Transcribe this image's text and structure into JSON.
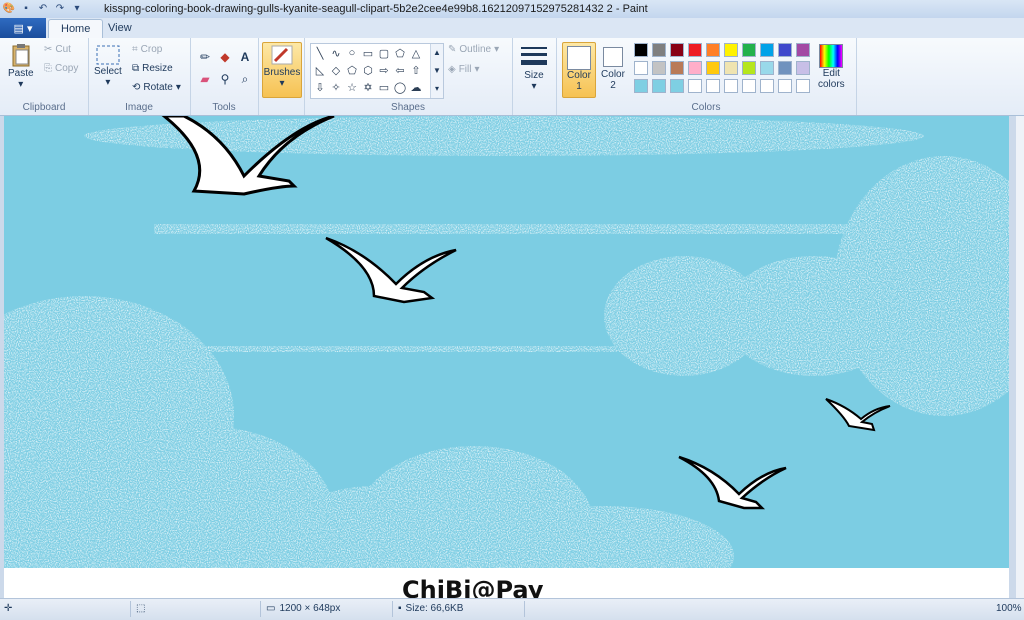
{
  "window": {
    "title": "kisspng-coloring-book-drawing-gulls-kyanite-seagull-clipart-5b2e2cee4e99b8.16212097152975281432 2 - Paint"
  },
  "tabs": [
    {
      "label": "Home"
    },
    {
      "label": "View"
    }
  ],
  "clipboard": {
    "paste": "Paste",
    "cut": "Cut",
    "copy": "Copy",
    "group": "Clipboard"
  },
  "image": {
    "select": "Select",
    "crop": "Crop",
    "resize": "Resize",
    "rotate": "Rotate",
    "group": "Image"
  },
  "tools": {
    "group": "Tools"
  },
  "brushes": {
    "label": "Brushes"
  },
  "shapes": {
    "outline": "Outline",
    "fill": "Fill",
    "group": "Shapes"
  },
  "size": {
    "label": "Size"
  },
  "colors": {
    "color1": "Color\n1",
    "color1_a": "Color",
    "color1_b": "1",
    "color2_a": "Color",
    "color2_b": "2",
    "edit": "Edit colors",
    "edit_a": "Edit",
    "edit_b": "colors",
    "group": "Colors",
    "palette": [
      "#000000",
      "#7f7f7f",
      "#880015",
      "#ed1c24",
      "#ff7f27",
      "#fff200",
      "#22b14c",
      "#00a2e8",
      "#3f48cc",
      "#a349a4",
      "#ffffff",
      "#c3c3c3",
      "#b97a57",
      "#ffaec9",
      "#ffc90e",
      "#efe4b0",
      "#b5e61d",
      "#99d9ea",
      "#7092be",
      "#c8bfe7",
      "#7ecfe3",
      "#7ecfe3",
      "#7ecfe3",
      "#ffffff",
      "#ffffff",
      "#ffffff",
      "#ffffff",
      "#ffffff",
      "#ffffff",
      "#ffffff"
    ],
    "sky": "#7ccde3"
  },
  "canvas": {
    "watermark": "ChiBi@Pay"
  },
  "status": {
    "dimensions": "1200 × 648px",
    "size": "Size: 66,6KB",
    "zoom": "100%"
  }
}
